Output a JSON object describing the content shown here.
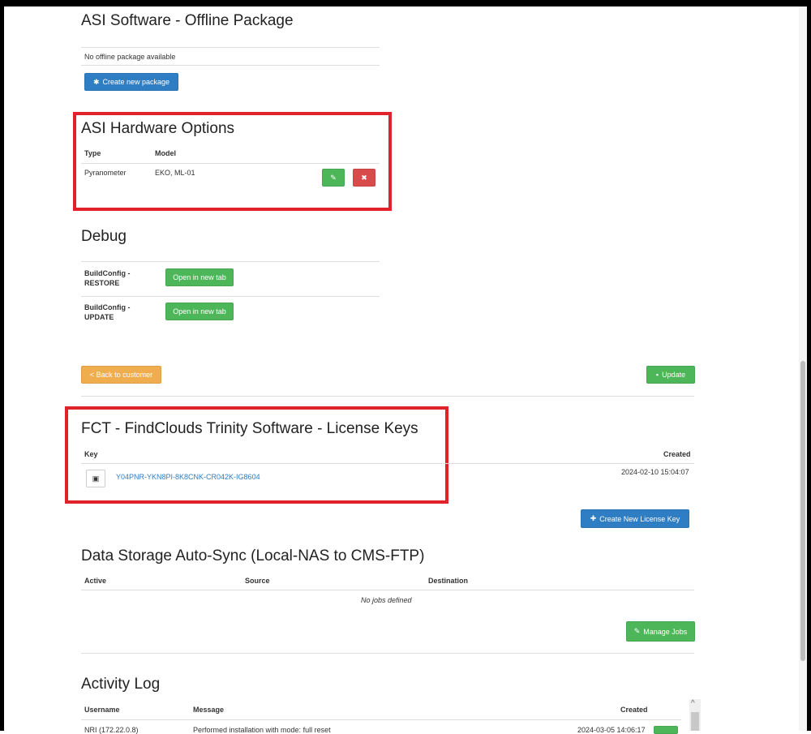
{
  "offline": {
    "title": "ASI Software - Offline Package",
    "empty_text": "No offline package available",
    "create_btn": "Create new package",
    "create_icon": "asterisk-icon"
  },
  "hardware": {
    "title": "ASI Hardware Options",
    "col_type": "Type",
    "col_model": "Model",
    "rows": [
      {
        "type": "Pyranometer",
        "model": "EKO, ML-01"
      }
    ]
  },
  "debug": {
    "title": "Debug",
    "rows": [
      {
        "label": "BuildConfig -\nRESTORE",
        "btn": "Open in new tab"
      },
      {
        "label": "BuildConfig -\nUPDATE",
        "btn": "Open in new tab"
      }
    ]
  },
  "actions": {
    "back": "< Back to customer",
    "update": "Update"
  },
  "license": {
    "title": "FCT - FindClouds Trinity Software - License Keys",
    "col_key": "Key",
    "col_created": "Created",
    "rows": [
      {
        "key": "Y04PNR-YKN8PI-8K8CNK-CR042K-IG8604",
        "created": "2024-02-10 15:04:07"
      }
    ],
    "create_btn": "Create New License Key"
  },
  "sync": {
    "title": "Data Storage Auto-Sync (Local-NAS to CMS-FTP)",
    "col_active": "Active",
    "col_source": "Source",
    "col_destination": "Destination",
    "empty_text": "No jobs defined",
    "manage_btn": "Manage Jobs"
  },
  "activity": {
    "title": "Activity Log",
    "col_username": "Username",
    "col_message": "Message",
    "col_created": "Created",
    "rows": [
      {
        "username": "NRI (172.22.0.8)",
        "message": "Performed installation with mode: full reset",
        "created": "2024-03-05 14:06:17"
      }
    ]
  },
  "colors": {
    "accent_blue": "#2f7dc2",
    "success_green": "#4db659",
    "danger_red": "#d94b4b",
    "warning_orange": "#f0ad4e",
    "highlight_red": "#e0222a"
  }
}
